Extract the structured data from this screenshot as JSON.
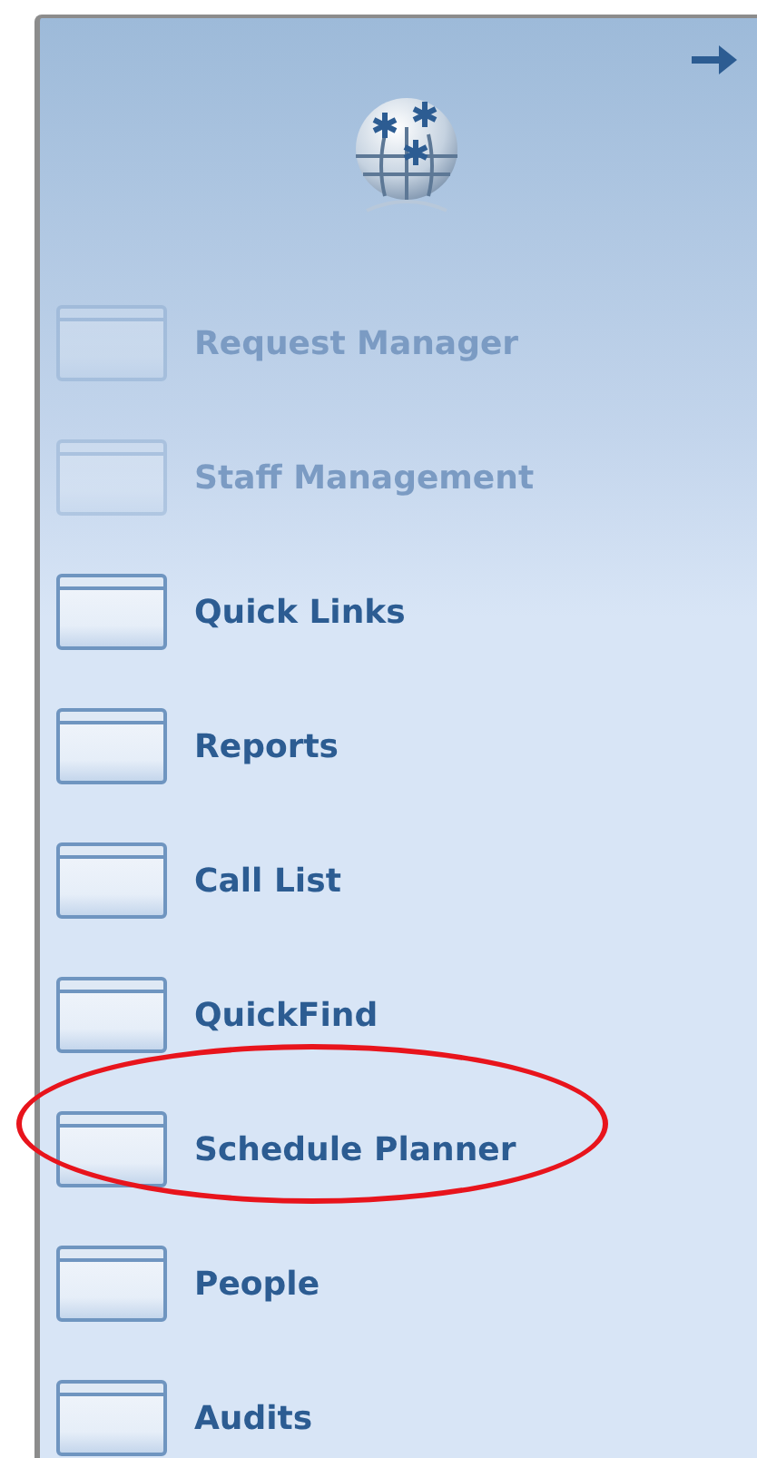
{
  "items": [
    {
      "label": "Request Manager",
      "disabled": true,
      "circled": false
    },
    {
      "label": "Staff Management",
      "disabled": true,
      "circled": false
    },
    {
      "label": "Quick Links",
      "disabled": false,
      "circled": false
    },
    {
      "label": "Reports",
      "disabled": false,
      "circled": false
    },
    {
      "label": "Call List",
      "disabled": false,
      "circled": false
    },
    {
      "label": "QuickFind",
      "disabled": false,
      "circled": false
    },
    {
      "label": "Schedule Planner",
      "disabled": false,
      "circled": true
    },
    {
      "label": "People",
      "disabled": false,
      "circled": false
    },
    {
      "label": "Audits",
      "disabled": false,
      "circled": false
    }
  ]
}
